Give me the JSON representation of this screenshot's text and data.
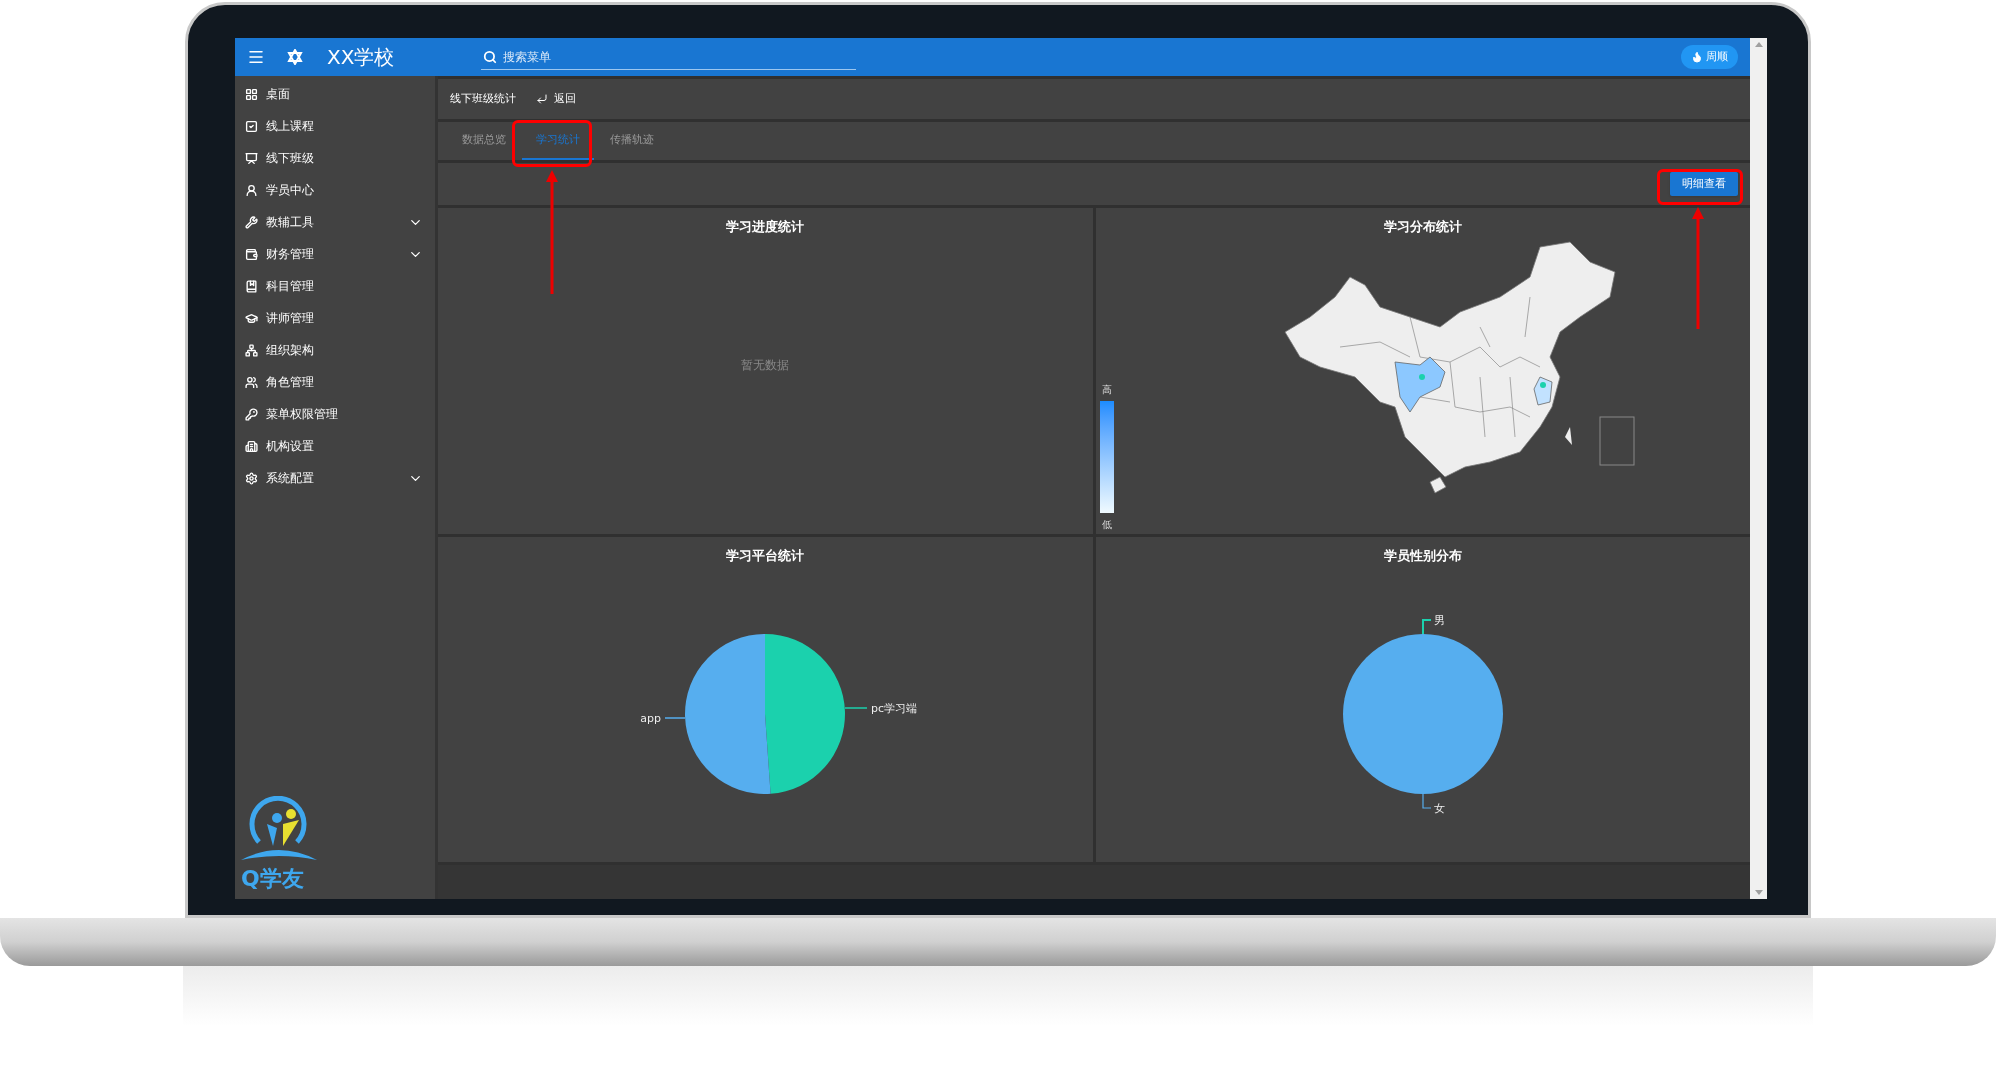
{
  "header": {
    "title": "XX学校",
    "search": {
      "placeholder": "搜索菜单"
    },
    "user": "周顺"
  },
  "sidebar": {
    "items": [
      {
        "label": "桌面",
        "expandable": false
      },
      {
        "label": "线上课程",
        "expandable": false
      },
      {
        "label": "线下班级",
        "expandable": false
      },
      {
        "label": "学员中心",
        "expandable": false
      },
      {
        "label": "教辅工具",
        "expandable": true
      },
      {
        "label": "财务管理",
        "expandable": true
      },
      {
        "label": "科目管理",
        "expandable": false
      },
      {
        "label": "讲师管理",
        "expandable": false
      },
      {
        "label": "组织架构",
        "expandable": false
      },
      {
        "label": "角色管理",
        "expandable": false
      },
      {
        "label": "菜单权限管理",
        "expandable": false
      },
      {
        "label": "机构设置",
        "expandable": false
      },
      {
        "label": "系统配置",
        "expandable": true
      }
    ],
    "logo_text": "Q学友"
  },
  "breadcrumb": {
    "title": "线下班级统计",
    "back": "返回"
  },
  "tabs": [
    {
      "label": "数据总览",
      "selected": false
    },
    {
      "label": "学习统计",
      "selected": true
    },
    {
      "label": "传播轨迹",
      "selected": false
    }
  ],
  "detail_button": "明细查看",
  "panels": [
    {
      "kind": "empty",
      "title": "学习进度统计",
      "empty_text": "暂无数据"
    },
    {
      "kind": "map",
      "title": "学习分布统计",
      "legend_high": "高",
      "legend_low": "低"
    },
    {
      "kind": "pie",
      "title": "学习平台统计",
      "slices": [
        {
          "label": "pc学习端",
          "color": "#1bd1ad"
        },
        {
          "label": "app",
          "color": "#56aeef"
        }
      ]
    },
    {
      "kind": "pie-single",
      "title": "学员性别分布",
      "slices": [
        {
          "label": "男",
          "color": "#1bd1ad"
        },
        {
          "label": "女",
          "color": "#56aeef"
        }
      ]
    }
  ]
}
